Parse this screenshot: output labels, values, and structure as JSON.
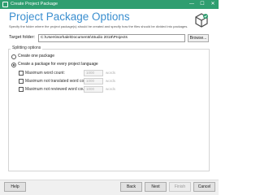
{
  "window": {
    "title": "Create Project Package",
    "minimize": "—",
    "maximize": "☐",
    "close": "✕"
  },
  "header": {
    "title": "Project Package Options",
    "subtitle": "Specify the folder where the project package(s) should be created and specify how the files should be divided into packages.",
    "icon": "package-icon"
  },
  "target": {
    "label": "Target folder:",
    "value": "C:\\Users\\sorhale\\Documents\\Studio 2018\\Projects",
    "browse_label": "Browse..."
  },
  "splitting": {
    "legend": "Splitting options",
    "options": [
      {
        "label": "Create one package",
        "selected": false
      },
      {
        "label": "Create a package for every project language",
        "selected": true
      }
    ],
    "limits": [
      {
        "label": "Maximum word count:",
        "value": "1000",
        "unit": "words",
        "checked": false
      },
      {
        "label": "Maximum not translated word count:",
        "value": "1000",
        "unit": "words",
        "checked": false
      },
      {
        "label": "Maximum not reviewed word count:",
        "value": "1000",
        "unit": "words",
        "checked": false
      }
    ]
  },
  "footer": {
    "help": "Help",
    "back": "Back",
    "next": "Next",
    "finish": "Finish",
    "cancel": "Cancel"
  },
  "colors": {
    "titlebar": "#2f9e70",
    "title_text": "#3a8ecf"
  }
}
